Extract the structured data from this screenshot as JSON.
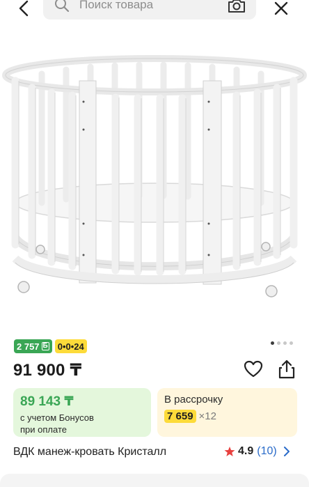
{
  "header": {
    "search_placeholder": "Поиск товара"
  },
  "product": {
    "badges": {
      "bonus": "2 757",
      "bonus_currency": "Б",
      "installment": "0•0•24"
    },
    "gallery": {
      "total": 4,
      "active": 0
    },
    "price": "91 900 ₸",
    "bonus_card": {
      "amount": "89 143 ₸",
      "note_line1": "с учетом Бонусов",
      "note_line2": "при оплате"
    },
    "installment_card": {
      "label": "В рассрочку",
      "monthly": "7 659",
      "months": "×12"
    },
    "title": "ВДК манеж-кровать Кристалл",
    "rating": {
      "score": "4.9",
      "count": "(10)"
    }
  },
  "colors": {
    "accent_green": "#3aa655",
    "accent_yellow": "#fddb3a",
    "star_red": "#e8413f",
    "link_blue": "#2a6bc9"
  },
  "icons": [
    "chevron-left-icon",
    "search-icon",
    "camera-icon",
    "close-icon",
    "heart-icon",
    "share-icon",
    "star-icon",
    "chevron-right-icon"
  ]
}
